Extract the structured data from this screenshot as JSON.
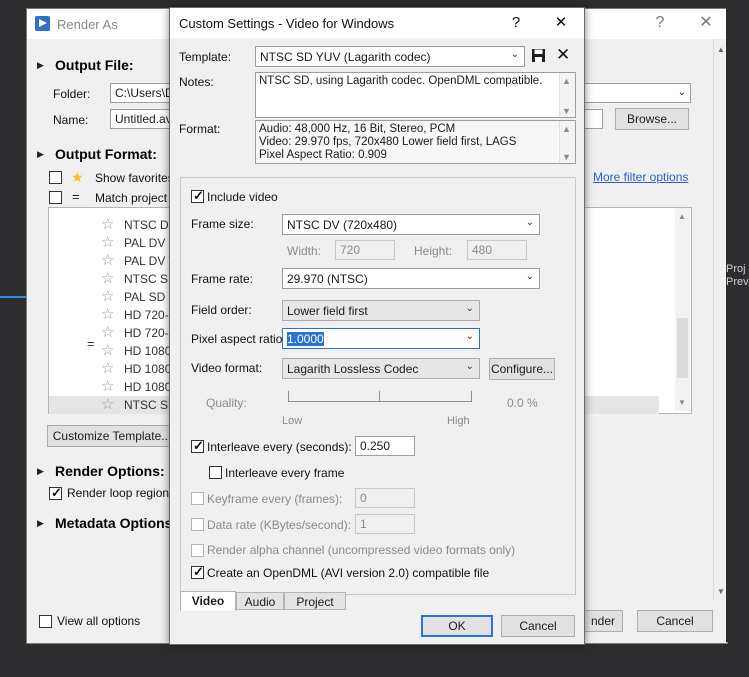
{
  "background": {
    "title": "Render As",
    "title_help": "?",
    "title_close": "✕",
    "output_file": "Output File:",
    "folder_label": "Folder:",
    "folder_value": "C:\\Users\\D",
    "name_label": "Name:",
    "name_value": "Untitled.avi",
    "browse": "Browse...",
    "output_format": "Output Format:",
    "show_favorites": "Show favorites",
    "match_project": "Match project",
    "more_filter": "More filter options",
    "templates": [
      "NTSC DV",
      "PAL DV",
      "PAL DV W",
      "NTSC SD",
      "PAL SD Y",
      "HD 720-",
      "HD 720-",
      "HD 1080",
      "HD 1080",
      "HD 1080",
      "NTSC SD"
    ],
    "customize_template": "Customize Template...",
    "render_options": "Render Options:",
    "render_loop": "Render loop region",
    "metadata_options": "Metadata Options",
    "view_all": "View all options",
    "render_button": "nder",
    "cancel": "Cancel",
    "strip_text1": "Proj",
    "strip_text2": "Prev"
  },
  "dialog": {
    "title": "Custom Settings - Video for Windows",
    "help": "?",
    "close": "✕",
    "template_label": "Template:",
    "template_value": "NTSC SD YUV (Lagarith codec)",
    "notes_label": "Notes:",
    "notes_value": "NTSC SD, using Lagarith codec. OpenDML compatible.",
    "format_label": "Format:",
    "format_lines": [
      "Audio: 48,000 Hz, 16 Bit, Stereo, PCM",
      "Video: 29.970 fps, 720x480 Lower field first, LAGS",
      "Pixel Aspect Ratio: 0.909"
    ],
    "include_video": "Include video",
    "frame_size_label": "Frame size:",
    "frame_size_value": "NTSC DV (720x480)",
    "width_label": "Width:",
    "width_value": "720",
    "height_label": "Height:",
    "height_value": "480",
    "frame_rate_label": "Frame rate:",
    "frame_rate_value": "29.970 (NTSC)",
    "field_order_label": "Field order:",
    "field_order_value": "Lower field first",
    "par_label": "Pixel aspect ratio:",
    "par_value": "1.0000",
    "video_format_label": "Video format:",
    "video_format_value": "Lagarith Lossless Codec",
    "configure": "Configure...",
    "quality_label": "Quality:",
    "quality_low": "Low",
    "quality_high": "High",
    "quality_value": "0.0 %",
    "interleave_label": "Interleave every (seconds):",
    "interleave_value": "0.250",
    "interleave_frame": "Interleave every frame",
    "keyframe_label": "Keyframe every (frames):",
    "keyframe_value": "0",
    "datarate_label": "Data rate (KBytes/second):",
    "datarate_value": "1",
    "alpha_label": "Render alpha channel (uncompressed video formats only)",
    "opendml_label": "Create an OpenDML (AVI version 2.0) compatible file",
    "tabs": [
      "Video",
      "Audio",
      "Project"
    ],
    "ok": "OK",
    "cancel": "Cancel"
  }
}
